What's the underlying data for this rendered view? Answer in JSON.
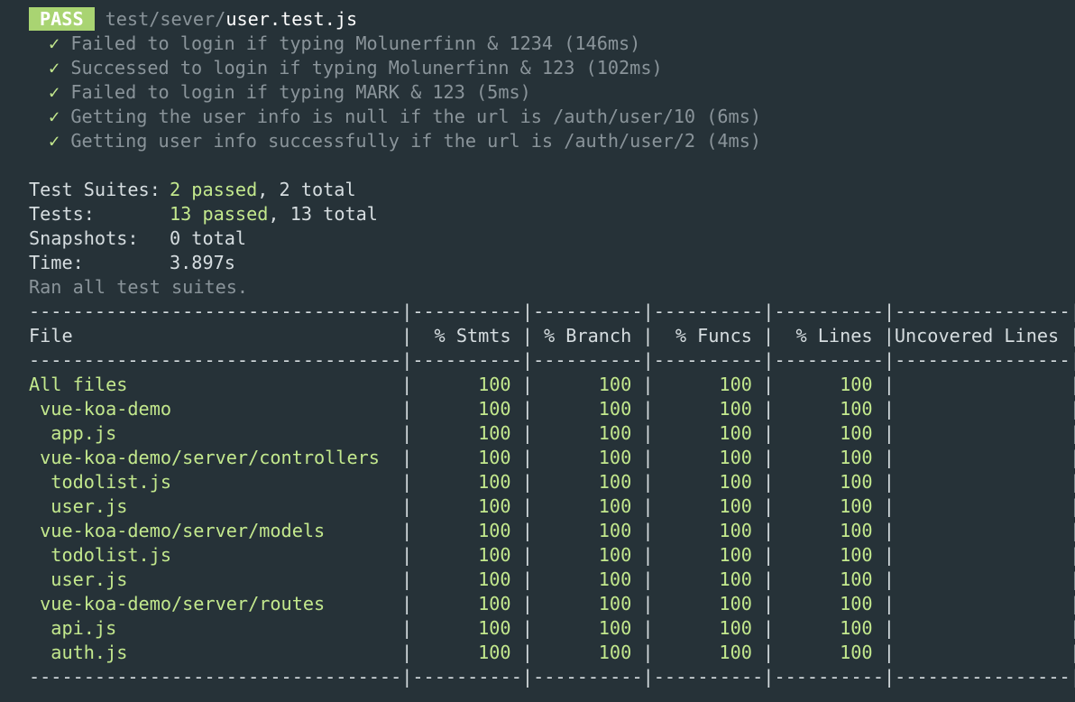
{
  "header": {
    "badge": "PASS",
    "path_dim": "test/sever/",
    "path_bright": "user.test.js"
  },
  "icons": {
    "check": "check-mark-icon"
  },
  "tests": [
    {
      "mark": "✓",
      "name": "Failed to login if typing Molunerfinn & 1234 (146ms)"
    },
    {
      "mark": "✓",
      "name": "Successed to login if typing Molunerfinn & 123 (102ms)"
    },
    {
      "mark": "✓",
      "name": "Failed to login if typing MARK & 123 (5ms)"
    },
    {
      "mark": "✓",
      "name": "Getting the user info is null if the url is /auth/user/10 (6ms)"
    },
    {
      "mark": "✓",
      "name": "Getting user info successfully if the url is /auth/user/2 (4ms)"
    }
  ],
  "summary": {
    "suites_label": "Test Suites:",
    "suites_passed": "2 passed",
    "suites_total": ", 2 total",
    "tests_label": "Tests:",
    "tests_passed": "13 passed",
    "tests_total": ", 13 total",
    "snapshots_label": "Snapshots:",
    "snapshots_value": "0 total",
    "time_label": "Time:",
    "time_value": "3.897s",
    "ran_all": "Ran all test suites."
  },
  "coverage": {
    "divider": "----------------------------------|----------|----------|----------|----------|----------------|",
    "headers": {
      "file": "File",
      "stmts": "% Stmts",
      "branch": "% Branch",
      "funcs": "% Funcs",
      "lines": "% Lines",
      "uncovered": "Uncovered Lines"
    },
    "rows": [
      {
        "file": "All files",
        "stmts": "100",
        "branch": "100",
        "funcs": "100",
        "lines": "100",
        "uncovered": ""
      },
      {
        "file": " vue-koa-demo",
        "stmts": "100",
        "branch": "100",
        "funcs": "100",
        "lines": "100",
        "uncovered": ""
      },
      {
        "file": "  app.js",
        "stmts": "100",
        "branch": "100",
        "funcs": "100",
        "lines": "100",
        "uncovered": ""
      },
      {
        "file": " vue-koa-demo/server/controllers",
        "stmts": "100",
        "branch": "100",
        "funcs": "100",
        "lines": "100",
        "uncovered": ""
      },
      {
        "file": "  todolist.js",
        "stmts": "100",
        "branch": "100",
        "funcs": "100",
        "lines": "100",
        "uncovered": ""
      },
      {
        "file": "  user.js",
        "stmts": "100",
        "branch": "100",
        "funcs": "100",
        "lines": "100",
        "uncovered": ""
      },
      {
        "file": " vue-koa-demo/server/models",
        "stmts": "100",
        "branch": "100",
        "funcs": "100",
        "lines": "100",
        "uncovered": ""
      },
      {
        "file": "  todolist.js",
        "stmts": "100",
        "branch": "100",
        "funcs": "100",
        "lines": "100",
        "uncovered": ""
      },
      {
        "file": "  user.js",
        "stmts": "100",
        "branch": "100",
        "funcs": "100",
        "lines": "100",
        "uncovered": ""
      },
      {
        "file": " vue-koa-demo/server/routes",
        "stmts": "100",
        "branch": "100",
        "funcs": "100",
        "lines": "100",
        "uncovered": ""
      },
      {
        "file": "  api.js",
        "stmts": "100",
        "branch": "100",
        "funcs": "100",
        "lines": "100",
        "uncovered": ""
      },
      {
        "file": "  auth.js",
        "stmts": "100",
        "branch": "100",
        "funcs": "100",
        "lines": "100",
        "uncovered": ""
      }
    ]
  },
  "colors": {
    "background": "#263238",
    "pass_badge": "#a9d472",
    "green": "#c3e88d",
    "dim": "#8a949a",
    "text": "#d6dde0"
  }
}
